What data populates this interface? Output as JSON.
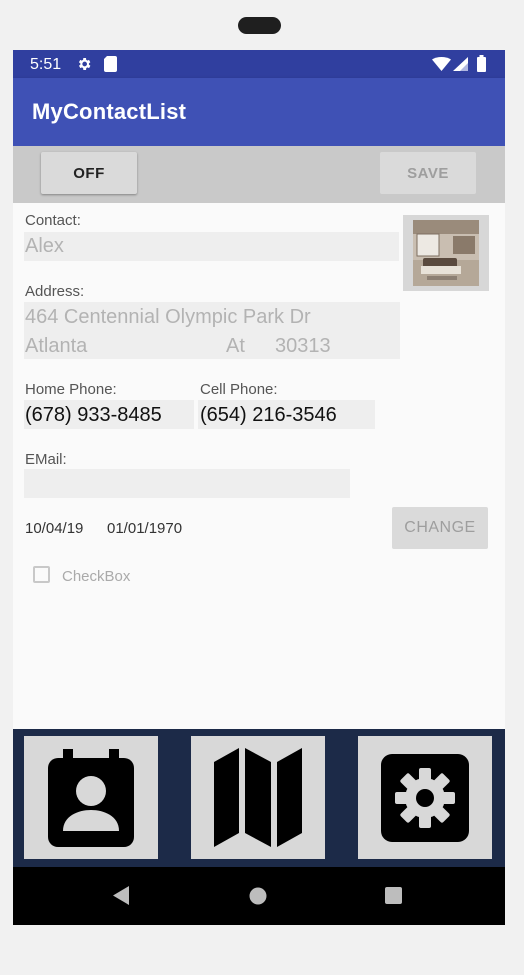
{
  "status_bar": {
    "time": "5:51",
    "icons": [
      "settings-icon",
      "sd-card-icon",
      "wifi-icon",
      "signal-icon",
      "battery-icon"
    ]
  },
  "app_bar": {
    "title": "MyContactList"
  },
  "toolbar": {
    "edit_toggle_label": "OFF",
    "save_label": "SAVE"
  },
  "form": {
    "contact_label": "Contact:",
    "contact_value": "Alex",
    "address_label": "Address:",
    "address_line1": "464 Centennial Olympic Park Dr",
    "city": "Atlanta",
    "state": "At",
    "zip": "30313",
    "home_phone_label": "Home Phone:",
    "home_phone_value": "(678) 933-8485",
    "cell_phone_label": "Cell Phone:",
    "cell_phone_value": "(654) 216-3546",
    "email_label": "EMail:",
    "email_value": "",
    "date_primary": "10/04/19",
    "date_secondary": "01/01/1970",
    "change_label": "CHANGE",
    "checkbox_label": "CheckBox",
    "checkbox_checked": false
  },
  "bottom_nav": [
    "contacts-icon",
    "map-icon",
    "settings-icon"
  ],
  "system_nav": [
    "back-icon",
    "home-icon",
    "recents-icon"
  ],
  "colors": {
    "status_bar": "#303f9f",
    "app_bar": "#3f51b5",
    "bottom_nav": "#1c2a48",
    "toolbar": "#c9c9c9"
  }
}
